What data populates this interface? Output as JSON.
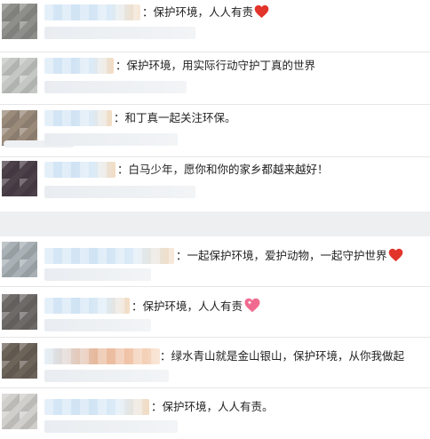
{
  "colors": {
    "heart_red": "#e2342b",
    "heart_pink": "#f06a8f",
    "gap_gray": "#eeeff1",
    "text": "#222222"
  },
  "section_one": {
    "comments": [
      {
        "text": "：保护环境，人人有责",
        "icon": "red-heart-icon"
      },
      {
        "text": "：保护环境，用实际行动守护丁真的世界"
      },
      {
        "text": "：和丁真一起关注环保。"
      },
      {
        "text": "：白马少年，愿你和你的家乡都越来越好！"
      }
    ]
  },
  "section_two": {
    "comments": [
      {
        "text": "：一起保护环境，爱护动物，一起守护世界",
        "icon": "red-heart-icon"
      },
      {
        "text": "：保护环境，人人有责",
        "icon": "sparkling-heart-icon"
      },
      {
        "text": "：绿水青山就是金山银山，保护环境，从你我做起"
      },
      {
        "text": "：保护环境，人人有责。"
      }
    ]
  }
}
